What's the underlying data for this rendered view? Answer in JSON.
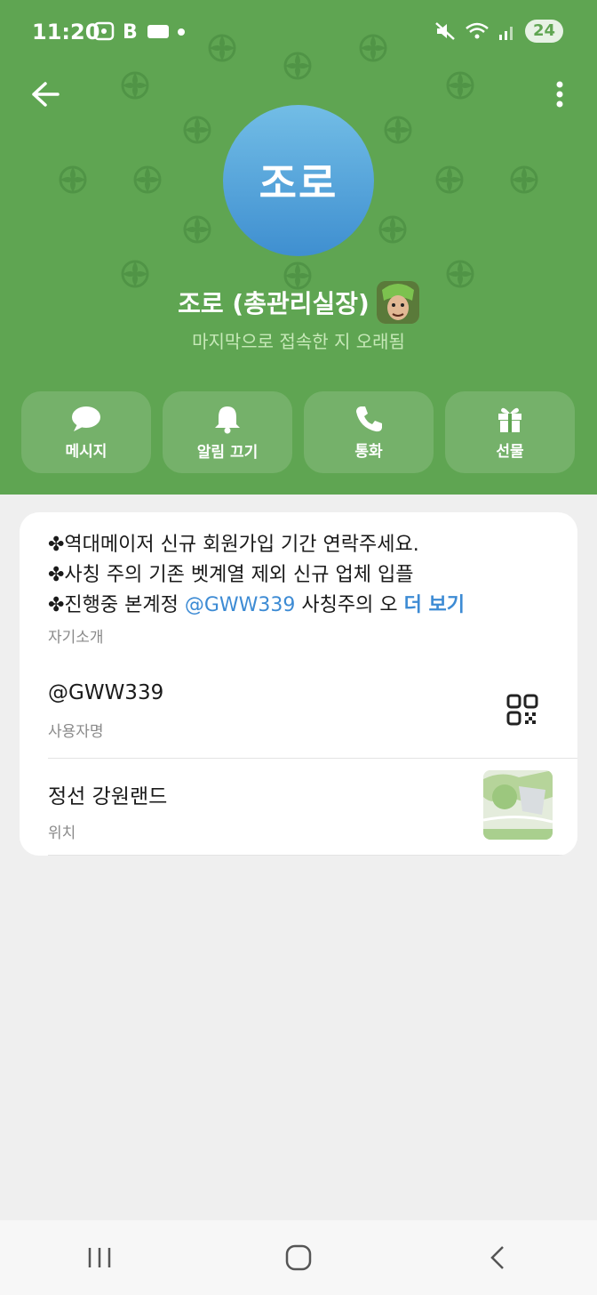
{
  "status_bar": {
    "time": "11:20",
    "battery": "24",
    "icons": [
      "screenshot-icon",
      "b-app-icon",
      "ticket-icon",
      "dot-icon",
      "mute-icon",
      "wifi-icon",
      "signal-icon"
    ]
  },
  "header": {
    "background": "#5fa552",
    "avatar_text": "조로",
    "avatar_color": "#4a9ad8",
    "name": "조로 (총관리실장)",
    "last_seen": "마지막으로 접속한 지 오래됨"
  },
  "actions": [
    {
      "label": "메시지",
      "icon": "chat-icon"
    },
    {
      "label": "알림 끄기",
      "icon": "bell-icon"
    },
    {
      "label": "통화",
      "icon": "phone-icon"
    },
    {
      "label": "선물",
      "icon": "gift-icon"
    }
  ],
  "profile": {
    "bio": {
      "line1": "✤역대메이저 신규 회원가입 기간 연락주세요.",
      "line2": "✤사칭 주의 기존 벳계열 제외 신규 업체 입플",
      "line3_prefix": "✤진행중 본계정 ",
      "line3_mention": "@GWW339",
      "line3_suffix": " 사칭주의 오",
      "more": "더 보기"
    },
    "bio_label": "자기소개",
    "username": "@GWW339",
    "username_label": "사용자명",
    "location": "정선 강원랜드",
    "location_label": "위치"
  },
  "accent_color": "#3d8bd4"
}
